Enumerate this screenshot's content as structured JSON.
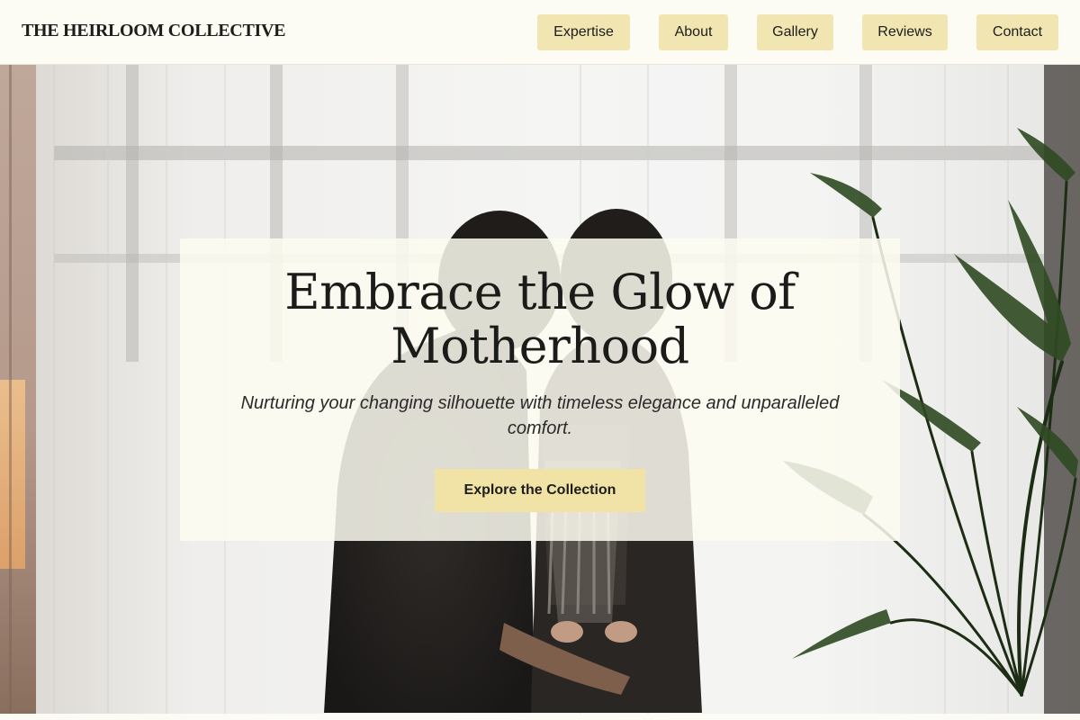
{
  "brand": {
    "name": "THE HEIRLOOM COLLECTIVE"
  },
  "nav": {
    "items": [
      {
        "label": "Expertise"
      },
      {
        "label": "About"
      },
      {
        "label": "Gallery"
      },
      {
        "label": "Reviews"
      },
      {
        "label": "Contact"
      }
    ]
  },
  "hero": {
    "title": "Embrace the Glow of Motherhood",
    "subtitle": "Nurturing your changing silhouette with timeless elegance and unparalleled comfort.",
    "cta_label": "Explore the Collection"
  },
  "colors": {
    "background": "#fdfcf4",
    "button": "#f1e6b2",
    "cta": "#f1e3a6",
    "text": "#1d1d1b"
  }
}
